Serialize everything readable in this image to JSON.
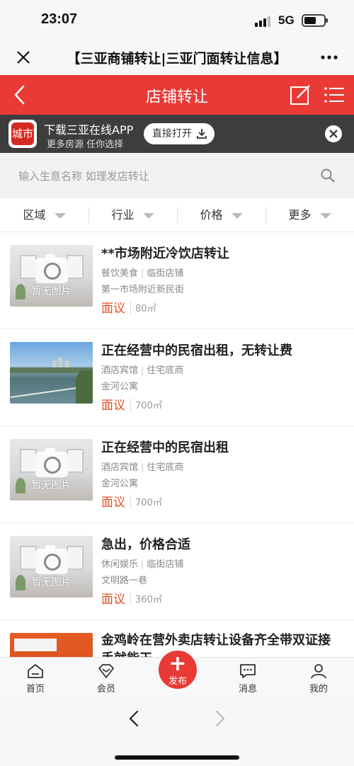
{
  "status": {
    "time": "23:07",
    "network": "5G",
    "battery_level": 0.6
  },
  "wechat": {
    "title": "【三亚商铺转让|三亚门面转让信息】"
  },
  "header": {
    "title": "店铺转让"
  },
  "banner": {
    "logo_text": "城市",
    "title": "下载三亚在线APP",
    "subtitle": "更多房源 任你选择",
    "open_label": "直接打开"
  },
  "search": {
    "placeholder": "输入生意名称  如理发店转让"
  },
  "filters": [
    {
      "label": "区域"
    },
    {
      "label": "行业"
    },
    {
      "label": "价格"
    },
    {
      "label": "更多"
    }
  ],
  "listings": [
    {
      "title": "**市场附近冷饮店转让",
      "category": "餐饮美食",
      "type": "临街店铺",
      "address": "第一市场附近新民街",
      "price": "面议",
      "area": "80㎡",
      "image": "no-image",
      "image_label": "暂无图片"
    },
    {
      "title": "正在经营中的民宿出租，无转让费",
      "category": "酒店宾馆",
      "type": "住宅底商",
      "address": "金河公寓",
      "price": "面议",
      "area": "700㎡",
      "image": "lake-photo"
    },
    {
      "title": "正在经营中的民宿出租",
      "category": "酒店宾馆",
      "type": "住宅底商",
      "address": "金河公寓",
      "price": "面议",
      "area": "700㎡",
      "image": "no-image",
      "image_label": "暂无图片"
    },
    {
      "title": "急出，价格合适",
      "category": "休闲娱乐",
      "type": "临街店铺",
      "address": "文明路一巷",
      "price": "面议",
      "area": "360㎡",
      "image": "no-image",
      "image_label": "暂无图片"
    },
    {
      "title": "金鸡岭在营外卖店转让设备齐全带双证接手就能干",
      "image": "shop-photo"
    }
  ],
  "tabbar": {
    "home": "首页",
    "member": "会员",
    "publish": "发布",
    "messages": "消息",
    "mine": "我的"
  },
  "colors": {
    "accent": "#e93a36",
    "price": "#e4502a",
    "banner_bg": "#3d3d3d"
  }
}
